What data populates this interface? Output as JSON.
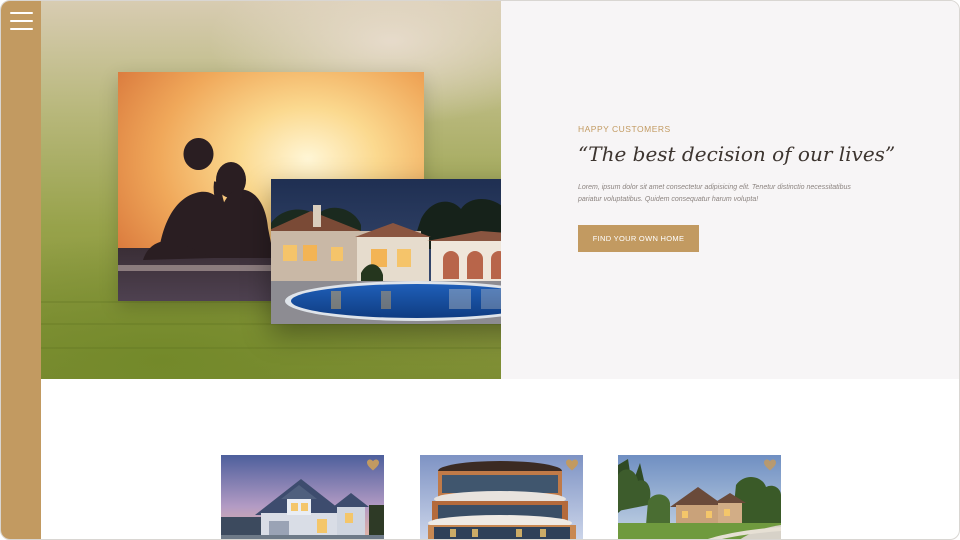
{
  "nav": {
    "menu_icon": "hamburger-menu-icon"
  },
  "testimonial": {
    "eyebrow": "HAPPY CUSTOMERS",
    "quote": "“The best decision of our lives”",
    "body_line1": "Lorem, ipsum dolor sit amet consectetur adipisicing elit. Tenetur distinctio necessitatibus",
    "body_line2": "pariatur voluptatibus. Quidem consequatur harum volupta!",
    "cta_label": "FIND YOUR OWN HOME"
  },
  "listings": [
    {
      "image": "blue-suburban-house-at-dusk",
      "favorite_icon": "heart-icon"
    },
    {
      "image": "round-modern-apartment-building",
      "favorite_icon": "heart-icon"
    },
    {
      "image": "country-house-with-trees",
      "favorite_icon": "heart-icon"
    }
  ],
  "colors": {
    "accent": "#c29a61",
    "heading": "#3d3530",
    "muted_text": "#8c8480",
    "panel_bg": "#f7f5f6"
  }
}
